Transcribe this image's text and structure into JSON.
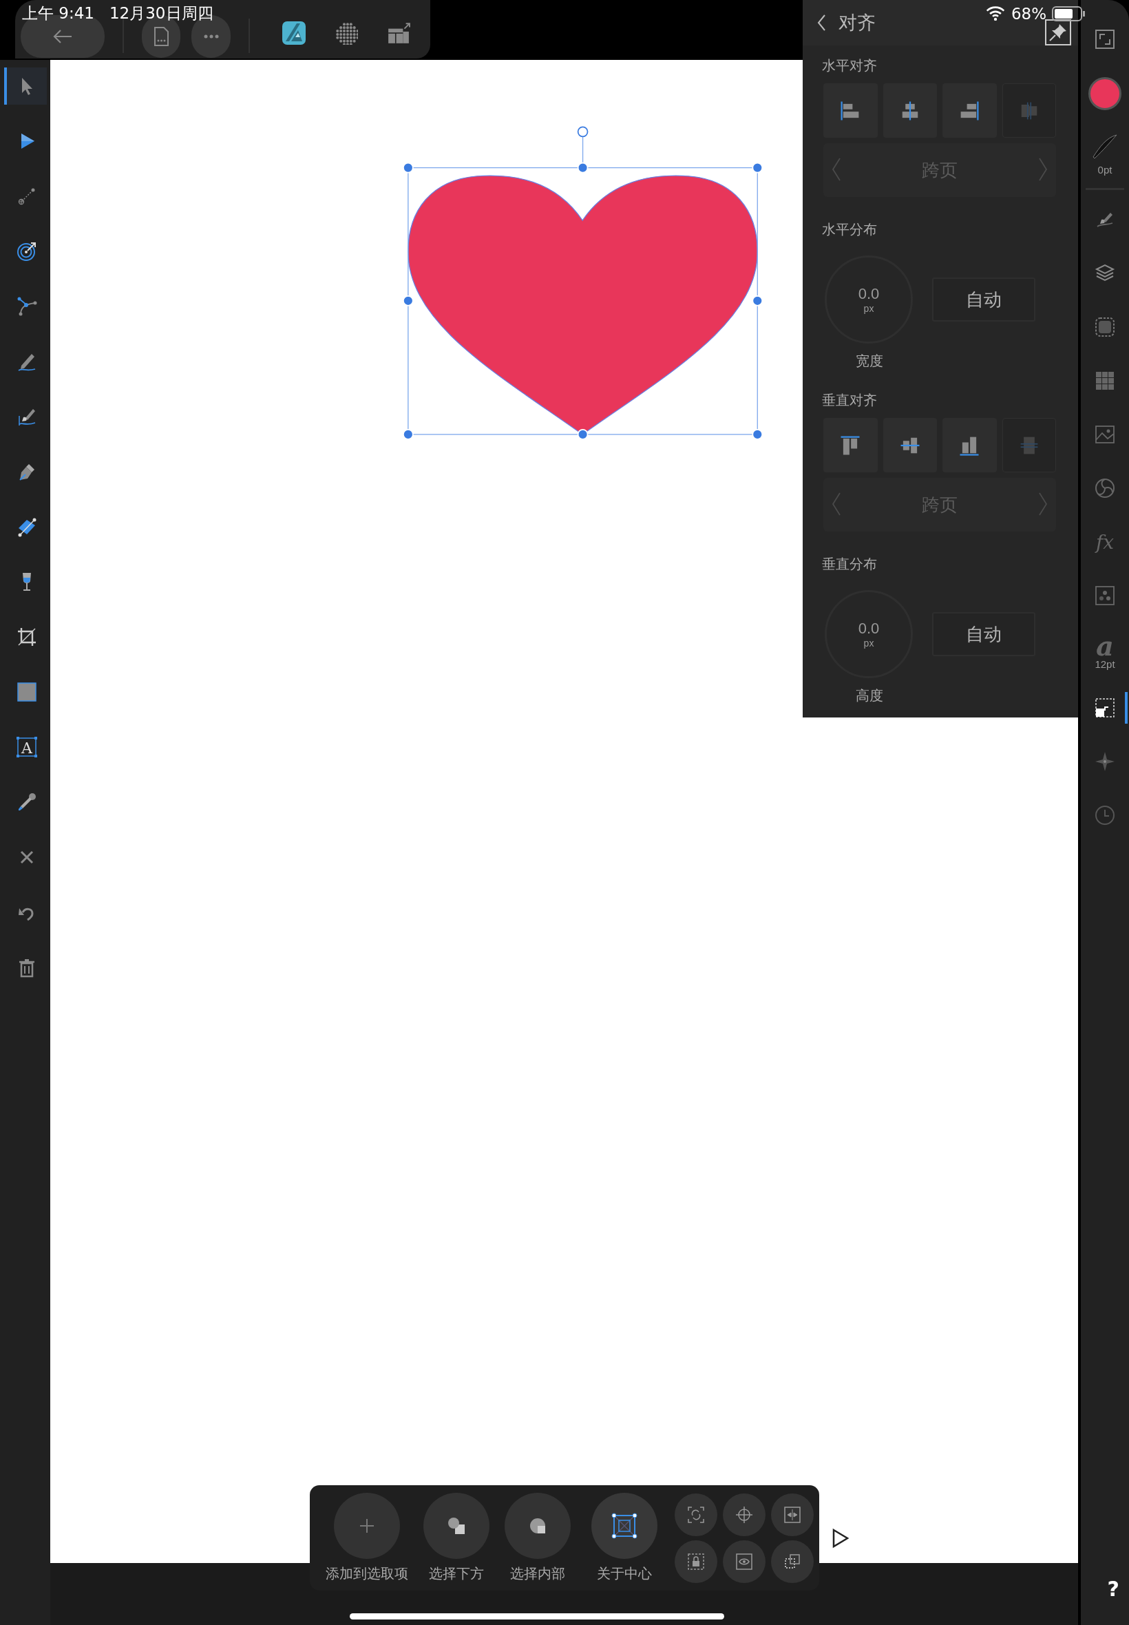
{
  "status_bar": {
    "time": "上午 9:41",
    "date": "12月30日周四",
    "battery": "68%"
  },
  "toolbar": {
    "buttons": [
      {
        "kind": "back"
      },
      {
        "kind": "document"
      },
      {
        "kind": "more"
      },
      {
        "kind": "persona"
      },
      {
        "kind": "pixel"
      },
      {
        "kind": "export"
      }
    ]
  },
  "tools": [
    {
      "kind": "move",
      "selected": true
    },
    {
      "kind": "node",
      "selected": false
    },
    {
      "kind": "corner",
      "selected": false
    },
    {
      "kind": "contour",
      "selected": false
    },
    {
      "kind": "point",
      "selected": false
    },
    {
      "kind": "pencil",
      "selected": false
    },
    {
      "kind": "brush",
      "selected": false
    },
    {
      "kind": "pen",
      "selected": false
    },
    {
      "kind": "gradient",
      "selected": false
    },
    {
      "kind": "transparency",
      "selected": false
    },
    {
      "kind": "crop",
      "selected": false
    },
    {
      "kind": "rectangle",
      "selected": false
    },
    {
      "kind": "text",
      "glyph": "A",
      "selected": false
    },
    {
      "kind": "eyedropper",
      "selected": false
    }
  ],
  "tools_bottom": [
    {
      "kind": "close"
    },
    {
      "kind": "undo"
    },
    {
      "kind": "delete"
    }
  ],
  "canvas": {
    "shape": {
      "kind": "heart",
      "color": "#e8365a",
      "selected": true
    }
  },
  "panel": {
    "title": "对齐",
    "sections": [
      {
        "kind": "align",
        "label": "水平对齐",
        "buttons": [
          {
            "kind": "left",
            "disabled": false
          },
          {
            "kind": "hcenter",
            "disabled": false
          },
          {
            "kind": "right",
            "disabled": false
          },
          {
            "kind": "hspread",
            "disabled": true
          }
        ],
        "stepper": {
          "value": "跨页",
          "disabled": true
        }
      },
      {
        "kind": "distribute",
        "label": "水平分布",
        "dial": {
          "value": "0.0",
          "unit": "px",
          "label": "宽度"
        },
        "button": "自动"
      },
      {
        "kind": "align",
        "label": "垂直对齐",
        "buttons": [
          {
            "kind": "top",
            "disabled": false
          },
          {
            "kind": "vcenter",
            "disabled": false
          },
          {
            "kind": "bottom",
            "disabled": false
          },
          {
            "kind": "vspread",
            "disabled": true
          }
        ],
        "stepper": {
          "value": "跨页",
          "disabled": true
        }
      },
      {
        "kind": "distribute",
        "label": "垂直分布",
        "dial": {
          "value": "0.0",
          "unit": "px",
          "label": "高度"
        },
        "button": "自动"
      }
    ]
  },
  "studio": [
    {
      "kind": "expand",
      "selected": false
    },
    {
      "kind": "fill",
      "color": "#e8365a",
      "selected": false
    },
    {
      "kind": "stroke",
      "label": "0pt",
      "selected": false
    },
    {
      "kind": "divider"
    },
    {
      "kind": "brushes",
      "selected": false
    },
    {
      "kind": "layers",
      "selected": false
    },
    {
      "kind": "mask",
      "selected": false
    },
    {
      "kind": "swatches",
      "selected": false
    },
    {
      "kind": "image",
      "selected": false
    },
    {
      "kind": "wheel",
      "selected": false
    },
    {
      "kind": "fx",
      "glyph": "fx",
      "selected": false
    },
    {
      "kind": "dots",
      "selected": false
    },
    {
      "kind": "textstyle",
      "glyph": "a",
      "label": "12pt",
      "selected": false
    },
    {
      "kind": "transform",
      "selected": true
    },
    {
      "kind": "navigator",
      "selected": false
    },
    {
      "kind": "history",
      "selected": false
    }
  ],
  "context_bar": {
    "actions": [
      {
        "kind": "add",
        "label": "添加到选取项",
        "selected": false
      },
      {
        "kind": "below",
        "label": "选择下方",
        "selected": false
      },
      {
        "kind": "inside",
        "label": "选择内部",
        "selected": false
      },
      {
        "kind": "center",
        "label": "关于中心",
        "selected": true
      }
    ],
    "small": [
      {
        "kind": "cycle"
      },
      {
        "kind": "target"
      },
      {
        "kind": "snap"
      },
      {
        "kind": "lock"
      },
      {
        "kind": "view"
      },
      {
        "kind": "duplicate"
      }
    ]
  },
  "play": {
    "kind": "play"
  },
  "help": "?"
}
